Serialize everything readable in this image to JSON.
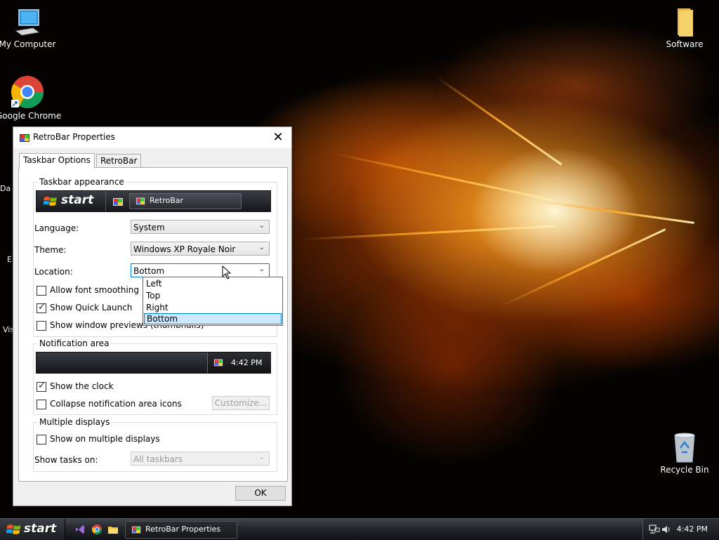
{
  "desktop": {
    "icons": [
      {
        "label": "My Computer"
      },
      {
        "label": "Google Chrome"
      },
      {
        "label": "Software"
      },
      {
        "label": "Recycle Bin"
      }
    ],
    "partial_labels": [
      "Da",
      "E",
      "Vis"
    ]
  },
  "dialog": {
    "title": "RetroBar Properties",
    "close_glyph": "✕",
    "tabs": [
      {
        "label": "Taskbar Options",
        "active": true
      },
      {
        "label": "RetroBar",
        "active": false
      }
    ],
    "appearance": {
      "group_title": "Taskbar appearance",
      "preview_start": "start",
      "preview_window": "RetroBar",
      "language_label": "Language:",
      "language_value": "System",
      "theme_label": "Theme:",
      "theme_value": "Windows XP Royale Noir",
      "location_label": "Location:",
      "location_value": "Bottom",
      "location_options": [
        "Left",
        "Top",
        "Right",
        "Bottom"
      ],
      "location_selected": "Bottom",
      "allow_font_smoothing": {
        "label": "Allow font smoothing",
        "checked": false
      },
      "show_quick_launch": {
        "label": "Show Quick Launch",
        "checked": true
      },
      "show_window_previews": {
        "label": "Show window previews (thumbnails)",
        "checked": false
      }
    },
    "notification": {
      "group_title": "Notification area",
      "preview_clock": "4:42 PM",
      "show_clock": {
        "label": "Show the clock",
        "checked": true
      },
      "collapse_icons": {
        "label": "Collapse notification area icons",
        "checked": false
      },
      "customize_label": "Customize..."
    },
    "multiple_displays": {
      "group_title": "Multiple displays",
      "show_on_multiple": {
        "label": "Show on multiple displays",
        "checked": false
      },
      "show_tasks_label": "Show tasks on:",
      "show_tasks_value": "All taskbars"
    },
    "ok_label": "OK"
  },
  "taskbar": {
    "start_label": "start",
    "window_button": "RetroBar Properties",
    "clock": "4:42 PM"
  },
  "colors": {
    "accent": "#0078d7",
    "selection": "#cce8ff"
  }
}
